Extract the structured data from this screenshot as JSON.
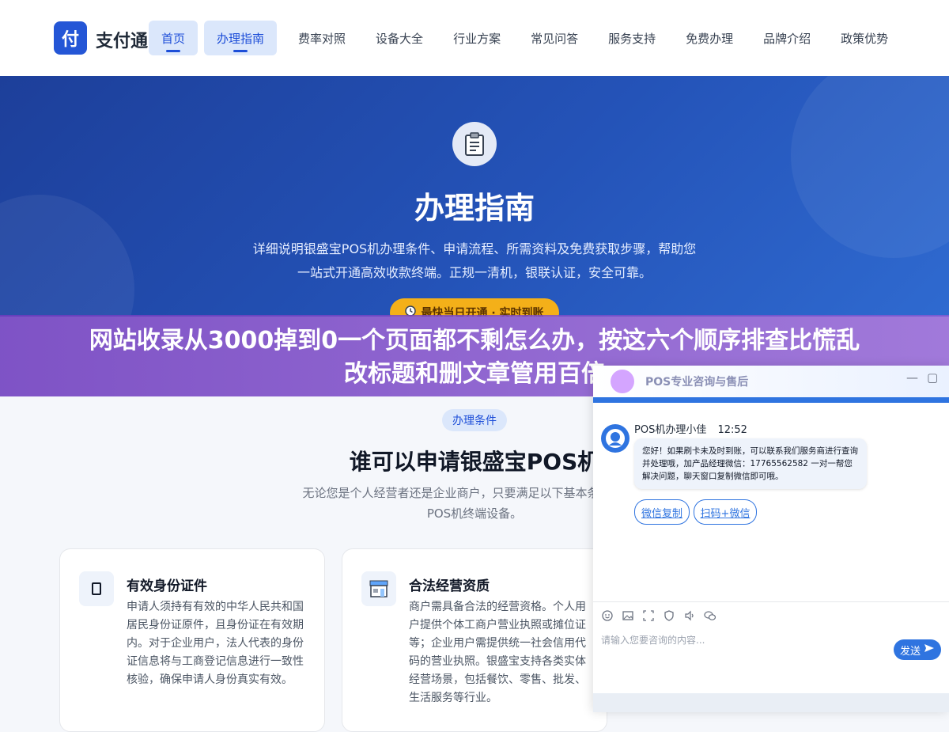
{
  "header": {
    "logo_char": "付",
    "brand": "支付通",
    "nav": [
      "首页",
      "办理指南",
      "费率对照",
      "设备大全",
      "行业方案",
      "常见问答",
      "服务支持",
      "免费办理",
      "品牌介绍",
      "政策优势"
    ]
  },
  "hero": {
    "icon": "clipboard-icon",
    "title": "办理指南",
    "desc_line1": "详细说明银盛宝POS机办理条件、申请流程、所需资料及免费获取步骤，帮助您",
    "desc_line2": "一站式开通高效收款终端。正规一清机，银联认证，安全可靠。",
    "badge": "最快当日开通 · 实时到账"
  },
  "overlay": {
    "line1": "网站收录从3000掉到0一个页面都不剩怎么办，按这六个顺序排查比慌乱",
    "line2": "改标题和删文章管用百倍"
  },
  "section": {
    "tag": "办理条件",
    "title": "谁可以申请银盛宝POS机",
    "desc_line1": "无论您是个人经营者还是企业商户，只要满足以下基本条件，即可",
    "desc_line2": "POS机终端设备。"
  },
  "cards": [
    {
      "title": "有效身份证件",
      "icon": "id-card-icon",
      "text": "申请人须持有有效的中华人民共和国居民身份证原件，且身份证在有效期内。对于企业用户，法人代表的身份证信息将与工商登记信息进行一致性核验，确保申请人身份真实有效。"
    },
    {
      "title": "合法经营资质",
      "icon": "shop-icon",
      "text": "商户需具备合法的经营资格。个人用户提供个体工商户营业执照或摊位证等；企业用户需提供统一社会信用代码的营业执照。银盛宝支持各类实体经营场景，包括餐饮、零售、批发、生活服务等行业。"
    }
  ],
  "chat": {
    "title": "POS专业咨询与售后",
    "minimize": "—",
    "maximize": "▢",
    "agent_name": "POS机办理小佳",
    "time": "12:52",
    "message": "您好！如果刷卡未及时到账，可以联系我们服务商进行查询并处理哦，加产品经理微信：17765562582 一对一帮您解决问题，聊天窗口复制微信即可哦。",
    "quick_replies": [
      "微信复制",
      "扫码+微信"
    ],
    "input_placeholder": "请输入您要咨询的内容...",
    "send": "发送"
  },
  "colors": {
    "primary": "#2456d6",
    "hero_gradient_start": "#1d3f9a",
    "badge": "#f4b019",
    "overlay": "#8050c8",
    "chat_accent": "#2f74e0"
  }
}
